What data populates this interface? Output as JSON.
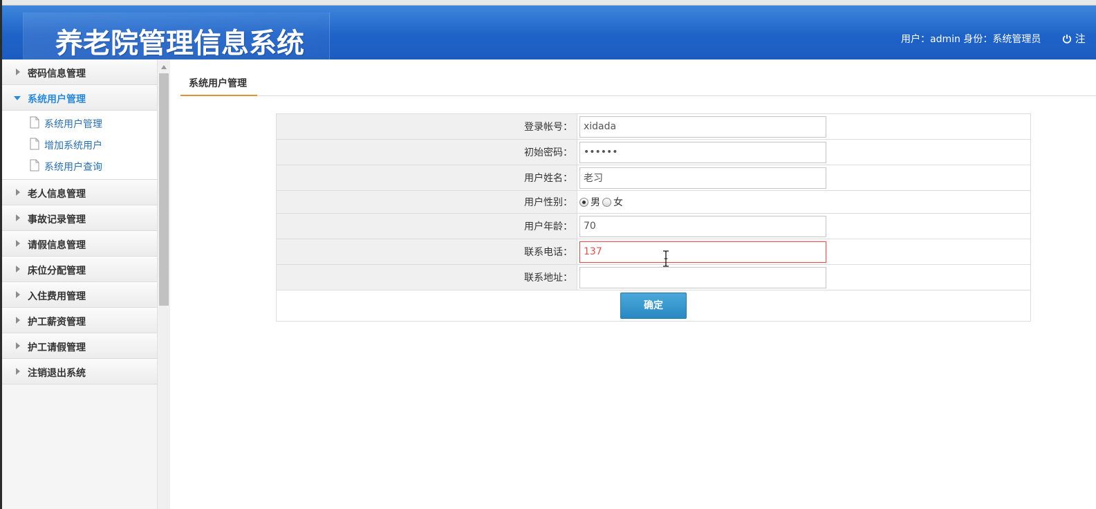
{
  "header": {
    "title": "养老院管理信息系统",
    "user_info": "用户：admin 身份：系统管理员",
    "logout_label": "注",
    "logout_icon": "power-icon"
  },
  "sidebar": {
    "items": [
      {
        "label": "密码信息管理"
      },
      {
        "label": "系统用户管理",
        "expanded": true,
        "children": [
          {
            "label": "系统用户管理"
          },
          {
            "label": "增加系统用户"
          },
          {
            "label": "系统用户查询"
          }
        ]
      },
      {
        "label": "老人信息管理"
      },
      {
        "label": "事故记录管理"
      },
      {
        "label": "请假信息管理"
      },
      {
        "label": "床位分配管理"
      },
      {
        "label": "入住费用管理"
      },
      {
        "label": "护工薪资管理"
      },
      {
        "label": "护工请假管理"
      },
      {
        "label": "注销退出系统"
      }
    ]
  },
  "main": {
    "tab_label": "系统用户管理",
    "form": {
      "login_account": {
        "label": "登录帐号：",
        "value": "xidada"
      },
      "initial_password": {
        "label": "初始密码：",
        "value": "••••••"
      },
      "user_name": {
        "label": "用户姓名：",
        "value": "老习"
      },
      "user_gender": {
        "label": "用户性别：",
        "option_male": "男",
        "option_female": "女",
        "selected": "男"
      },
      "user_age": {
        "label": "用户年龄：",
        "value": "70"
      },
      "contact_phone": {
        "label": "联系电话：",
        "value": "137"
      },
      "contact_address": {
        "label": "联系地址：",
        "value": ""
      },
      "submit_label": "确定"
    }
  },
  "colors": {
    "header_blue": "#1f63c8",
    "active_menu": "#2a8ad6",
    "tab_underline": "#e0922d",
    "focus_border": "#d9534f",
    "button_blue": "#2a88c2"
  }
}
